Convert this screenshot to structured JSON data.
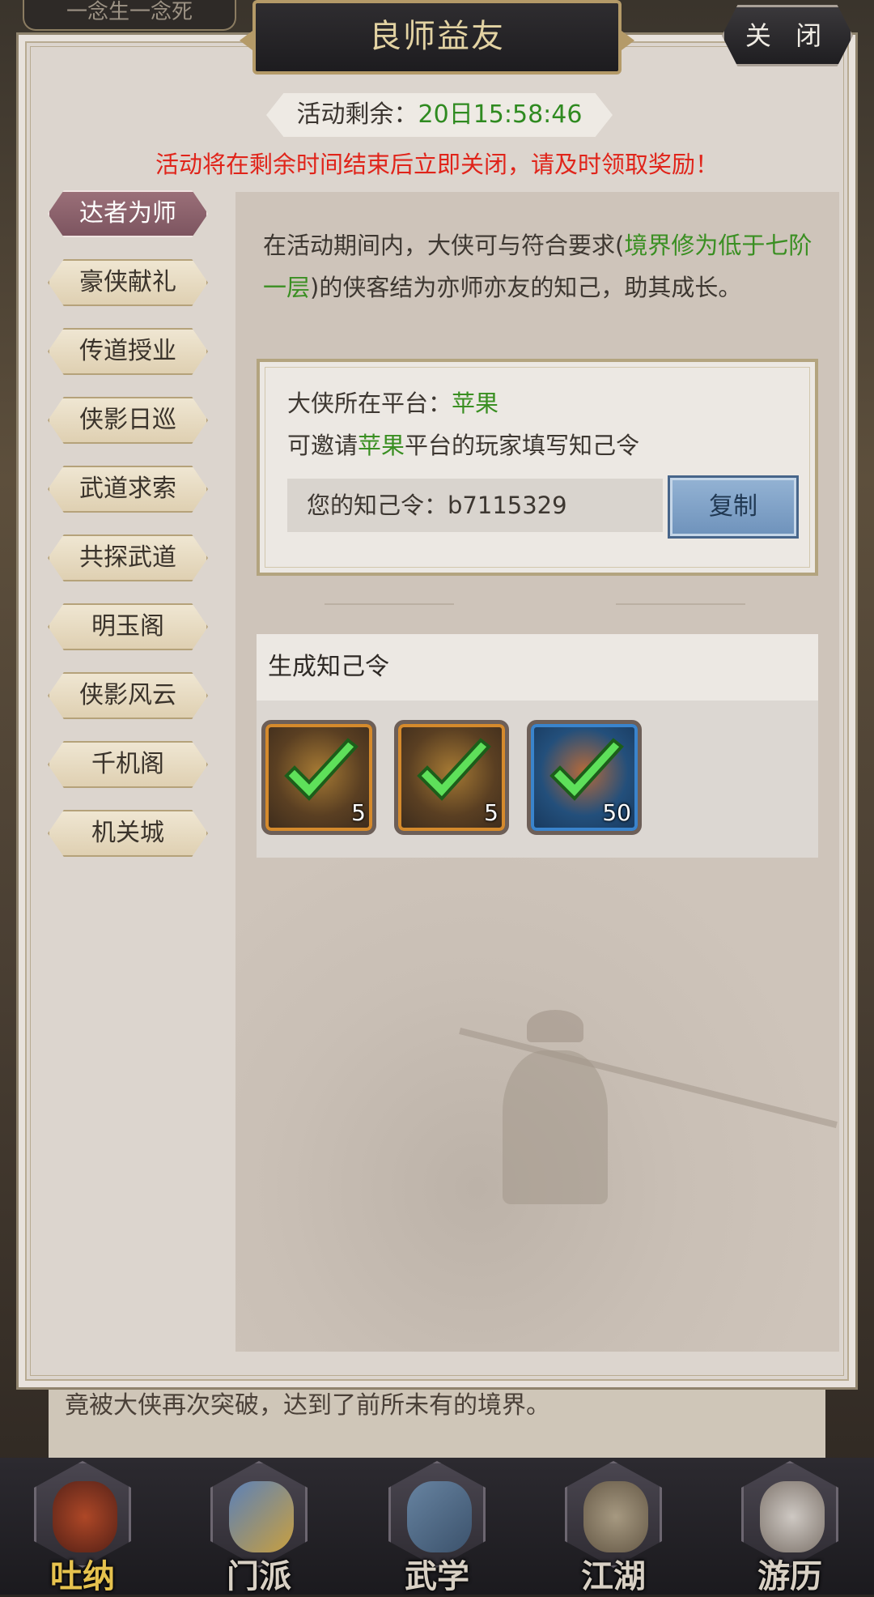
{
  "background": {
    "top_strip_text": "一念生一念死",
    "story_line_1": "竟被大侠再次突破，达到了前所未有的境界。",
    "story_line_2": "..."
  },
  "panel": {
    "title": "良师益友",
    "close_label": "关 闭",
    "timer_label": "活动剩余：",
    "timer_value": "20日15:58:46",
    "warning": "活动将在剩余时间结束后立即关闭，请及时领取奖励！"
  },
  "sidebar": {
    "tabs": [
      {
        "label": "达者为师",
        "active": true
      },
      {
        "label": "豪侠献礼",
        "active": false
      },
      {
        "label": "传道授业",
        "active": false
      },
      {
        "label": "侠影日巡",
        "active": false
      },
      {
        "label": "武道求索",
        "active": false
      },
      {
        "label": "共探武道",
        "active": false
      },
      {
        "label": "明玉阁",
        "active": false
      },
      {
        "label": "侠影风云",
        "active": false
      },
      {
        "label": "千机阁",
        "active": false
      },
      {
        "label": "机关城",
        "active": false
      }
    ]
  },
  "content": {
    "intro_1": "在活动期间内，大侠可与符合要求(",
    "intro_req": "境界修为低于七阶一层",
    "intro_2": ")的侠客结为亦师亦友的知己，助其成长。",
    "platform_label": "大侠所在平台：",
    "platform_value": "苹果",
    "invite_pre": "可邀请",
    "invite_platform": "苹果",
    "invite_post": "平台的玩家填写知己令",
    "code_label": "您的知己令：",
    "code_value": "b7115329",
    "copy_label": "复制",
    "generate_header": "生成知己令",
    "rewards": [
      {
        "icon": "coin-pouch-icon",
        "count": "5",
        "rarity": "orange",
        "claimed": true
      },
      {
        "icon": "book-icon",
        "count": "5",
        "rarity": "orange",
        "claimed": true
      },
      {
        "icon": "orb-icon",
        "count": "50",
        "rarity": "blue",
        "claimed": true
      }
    ]
  },
  "bottom_nav": [
    {
      "label": "吐纳",
      "icon": "meditation-icon",
      "active": true
    },
    {
      "label": "门派",
      "icon": "sect-icon",
      "active": false
    },
    {
      "label": "武学",
      "icon": "martial-book-icon",
      "active": false
    },
    {
      "label": "江湖",
      "icon": "hat-icon",
      "active": false
    },
    {
      "label": "游历",
      "icon": "horse-icon",
      "active": false
    }
  ],
  "colors": {
    "accent_green": "#3a8f22",
    "warning_red": "#e0241a",
    "active_tab": "#8a616b",
    "copy_button": "#7fa2c8"
  }
}
